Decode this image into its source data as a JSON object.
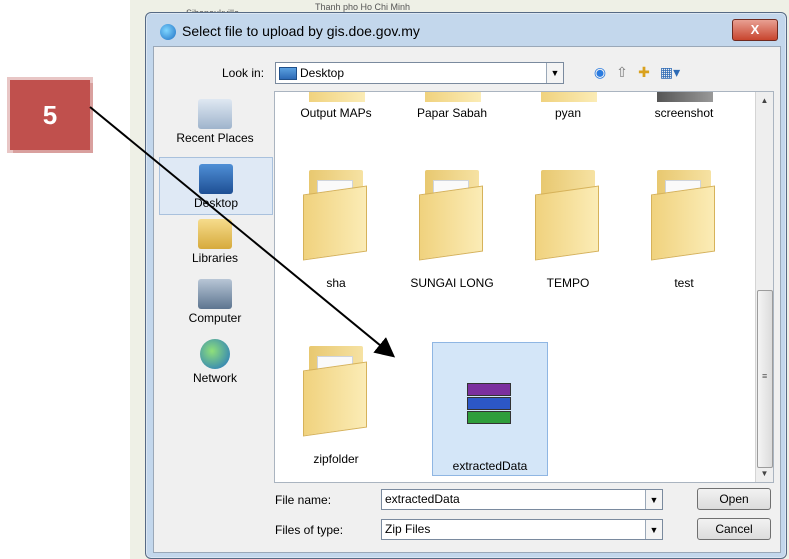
{
  "background_map": {
    "labels": [
      "Sihanoukville",
      "Thanh pho Ho Chi Minh"
    ]
  },
  "callout": {
    "step": "5"
  },
  "dialog": {
    "title": "Select file to upload by gis.doe.gov.my",
    "close_glyph": "X",
    "look_in_label": "Look in:",
    "look_in_value": "Desktop",
    "toolbar_icons": [
      "back-icon",
      "up-folder-icon",
      "new-folder-icon",
      "views-menu-icon"
    ],
    "places": [
      {
        "label": "Recent Places",
        "icon": "recent-places-icon"
      },
      {
        "label": "Desktop",
        "icon": "desktop-icon",
        "selected": true
      },
      {
        "label": "Libraries",
        "icon": "libraries-icon"
      },
      {
        "label": "Computer",
        "icon": "computer-icon"
      },
      {
        "label": "Network",
        "icon": "network-icon"
      }
    ],
    "files_partial_row": [
      "Output MAPs",
      "Papar Sabah",
      "pyan",
      "screenshot"
    ],
    "files_row2": [
      "sha",
      "SUNGAI LONG",
      "TEMPO",
      "test"
    ],
    "files_row3": [
      {
        "label": "zipfolder",
        "type": "folder"
      },
      {
        "label": "extractedData",
        "type": "winrar-archive",
        "selected": true
      }
    ],
    "file_name_label": "File name:",
    "file_name_value": "extractedData",
    "file_type_label": "Files of type:",
    "file_type_value": "Zip Files",
    "open_label": "Open",
    "cancel_label": "Cancel",
    "selection_color": "#d4e6f8",
    "close_color": "#c8452e"
  }
}
